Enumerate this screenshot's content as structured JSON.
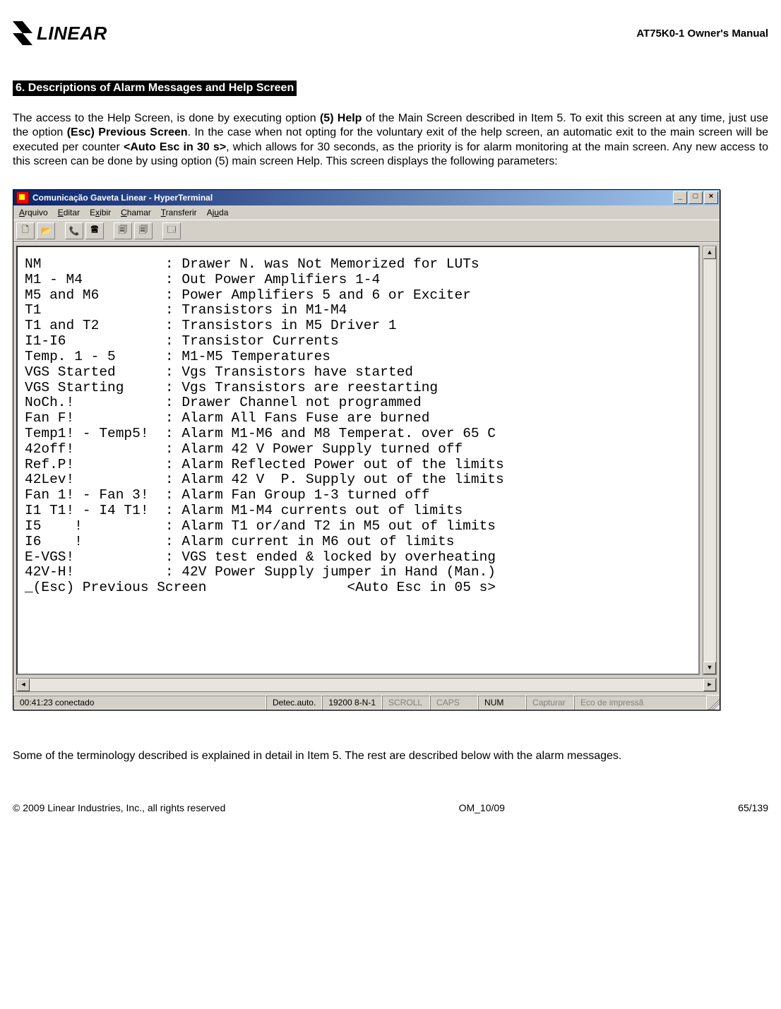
{
  "header": {
    "brand": "LINEAR",
    "doc_label": "AT75K0-1 Owner's Manual"
  },
  "section_heading": "6. Descriptions of Alarm Messages and Help Screen",
  "body_paragraph": {
    "p1a": "The access to the Help Screen, is done by executing option ",
    "p1b": "(5) Help",
    "p1c": " of the Main Screen described in Item 5. To exit this screen at any time, just use the option ",
    "p1d": "(Esc) Previous Screen",
    "p1e": ". In the case when not opting for the voluntary exit of the help screen, an automatic exit to the main screen will be executed per counter ",
    "p1f": "<Auto Esc in 30 s>",
    "p1g": ", which allows for 30 seconds, as the priority is for alarm monitoring at the main screen. Any new access to this screen can be done by using option (5) main screen Help. This screen displays the following parameters:"
  },
  "hyperterminal": {
    "title": "Comunicação Gaveta Linear - HyperTerminal",
    "menu": [
      "Arquivo",
      "Editar",
      "Exibir",
      "Chamar",
      "Transferir",
      "Ajuda"
    ],
    "menu_underline_idx": [
      0,
      0,
      1,
      0,
      0,
      2
    ],
    "toolbar_icons": [
      "new-doc-icon",
      "open-doc-icon",
      "connect-icon",
      "disconnect-icon",
      "send-icon",
      "receive-icon",
      "properties-icon"
    ],
    "toolbar_glyphs": [
      "🗋",
      "📂",
      "📞",
      "🖀",
      "🗐",
      "🗐",
      "🗔"
    ],
    "terminal_lines": [
      "NM               : Drawer N. was Not Memorized for LUTs",
      "M1 - M4          : Out Power Amplifiers 1-4",
      "M5 and M6        : Power Amplifiers 5 and 6 or Exciter",
      "T1               : Transistors in M1-M4",
      "T1 and T2        : Transistors in M5 Driver 1",
      "I1-I6            : Transistor Currents",
      "Temp. 1 - 5      : M1-M5 Temperatures",
      "VGS Started      : Vgs Transistors have started",
      "VGS Starting     : Vgs Transistors are reestarting",
      "NoCh.!           : Drawer Channel not programmed",
      "Fan F!           : Alarm All Fans Fuse are burned",
      "Temp1! - Temp5!  : Alarm M1-M6 and M8 Temperat. over 65 C",
      "42off!           : Alarm 42 V Power Supply turned off",
      "Ref.P!           : Alarm Reflected Power out of the limits",
      "42Lev!           : Alarm 42 V  P. Supply out of the limits",
      "Fan 1! - Fan 3!  : Alarm Fan Group 1-3 turned off",
      "I1 T1! - I4 T1!  : Alarm M1-M4 currents out of limits",
      "I5    !          : Alarm T1 or/and T2 in M5 out of limits",
      "I6    !          : Alarm current in M6 out of limits",
      "E-VGS!           : VGS test ended & locked by overheating",
      "42V-H!           : 42V Power Supply jumper in Hand (Man.)",
      "_(Esc) Previous Screen                 <Auto Esc in 05 s>"
    ],
    "status": {
      "time": "00:41:23 conectado",
      "detect": "Detec.auto.",
      "baud": "19200 8-N-1",
      "scroll": "SCROLL",
      "caps": "CAPS",
      "num": "NUM",
      "capture": "Capturar",
      "echo": "Eco de impressã"
    }
  },
  "after_paragraph": "Some of the terminology described is explained in detail in Item 5. The rest are described below with the alarm messages.",
  "footer": {
    "left": "© 2009 Linear Industries, Inc., all rights reserved",
    "center": "OM_10/09",
    "right": "65/139"
  }
}
